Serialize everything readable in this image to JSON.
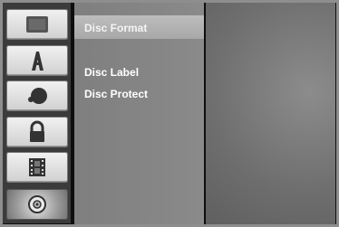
{
  "menu": {
    "items": [
      {
        "label": "Disc Format",
        "selected": true
      },
      {
        "label": ""
      },
      {
        "label": "Disc Label"
      },
      {
        "label": "Disc Protect"
      }
    ]
  },
  "sidebar": {
    "icons": [
      {
        "name": "general-settings-icon"
      },
      {
        "name": "language-icon"
      },
      {
        "name": "audio-icon"
      },
      {
        "name": "lock-icon"
      },
      {
        "name": "film-recording-icon"
      },
      {
        "name": "disc-icon",
        "active": true
      }
    ]
  },
  "colors": {
    "highlight": "#b4b4b4",
    "panel": "#858585",
    "frame": "#0e0e0e"
  }
}
